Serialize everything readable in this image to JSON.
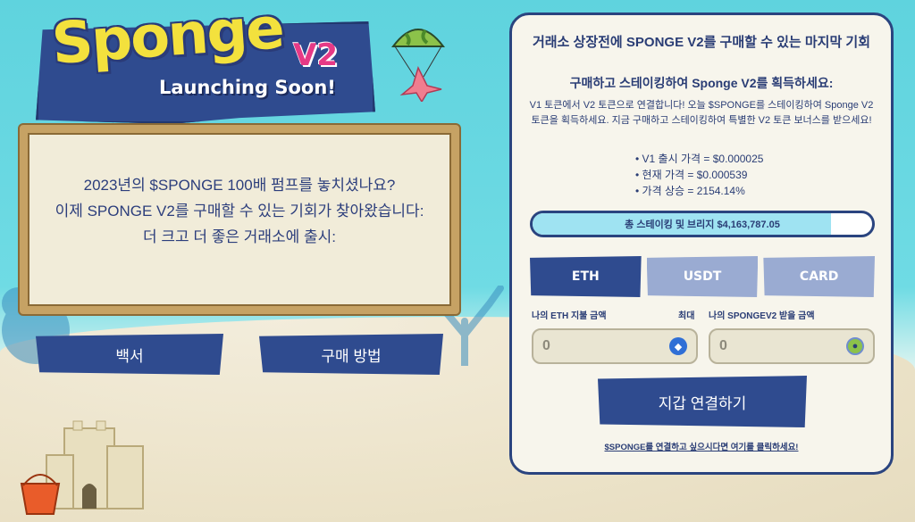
{
  "logo": {
    "name": "Sponge",
    "version": "V2",
    "tagline": "Launching Soon!"
  },
  "board": {
    "line1": "2023년의 $SPONGE 100배 펌프를 놓치셨나요?",
    "line2": "이제 SPONGE V2를 구매할 수 있는 기회가 찾아왔습니다:",
    "line3": "더 크고 더 좋은 거래소에 출시:"
  },
  "buttons": {
    "whitepaper": "백서",
    "how_to_buy": "구매 방법"
  },
  "panel": {
    "title": "거래소 상장전에 SPONGE V2를 구매할 수 있는 마지막 기회",
    "subtitle": "구매하고 스테이킹하여 Sponge V2를 획득하세요:",
    "description": "V1 토큰에서 V2 토큰으로 연결합니다! 오늘 $SPONGE를 스테이킹하여 Sponge V2 토큰을 획득하세요. 지금 구매하고 스테이킹하여 특별한 V2 토큰 보너스를 받으세요!",
    "stats": [
      "V1 출시 가격 = $0.000025",
      "현재 가격 = $0.000539",
      "가격 상승 = 2154.14%"
    ],
    "progress": {
      "label": "총 스테이킹 및 브리지 $4,163,787.05",
      "fill_percent": 88
    },
    "tabs": [
      "ETH",
      "USDT",
      "CARD"
    ],
    "pay_label": "나의 ETH 지불 금액",
    "max_label": "최대",
    "receive_label": "나의 SPONGEV2 받을 금액",
    "pay_value": "0",
    "receive_value": "0",
    "connect_label": "지갑 연결하기",
    "footer_link": "$SPONGE를 연결하고 싶으시다면 여기를 클릭하세요!"
  },
  "colors": {
    "navy": "#2f4b8f",
    "tab_inactive": "#9aabd2",
    "logo_yellow": "#f3e13d",
    "logo_pink": "#e63a86",
    "panel_bg": "#f7f5ec"
  }
}
